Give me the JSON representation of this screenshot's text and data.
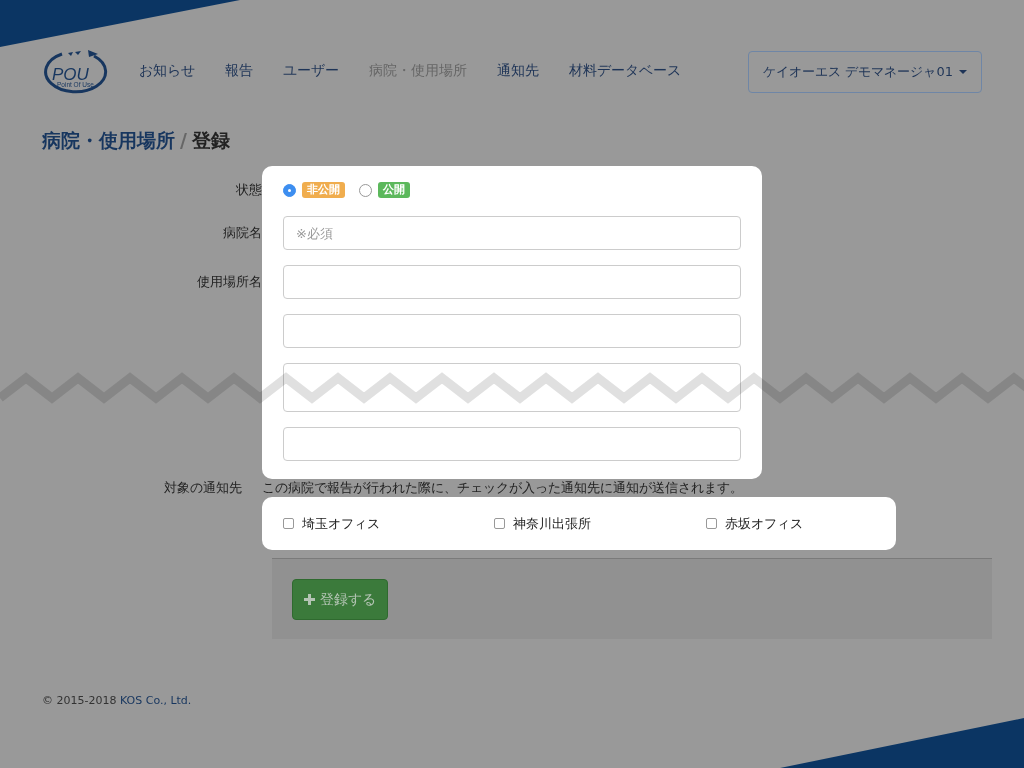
{
  "logo": {
    "text": "POU",
    "tagline": "Point Of Use"
  },
  "nav": [
    {
      "label": "お知らせ",
      "selected": false
    },
    {
      "label": "報告",
      "selected": false
    },
    {
      "label": "ユーザー",
      "selected": false
    },
    {
      "label": "病院・使用場所",
      "selected": true
    },
    {
      "label": "通知先",
      "selected": false
    },
    {
      "label": "材料データベース",
      "selected": false
    }
  ],
  "user_menu": {
    "label": "ケイオーエス デモマネージャ01"
  },
  "breadcrumb": {
    "parent": "病院・使用場所",
    "separator": "/",
    "current": "登録"
  },
  "status": {
    "label": "状態",
    "options": [
      {
        "label": "非公開",
        "selected": true,
        "color": "#f0ad4e"
      },
      {
        "label": "公開",
        "selected": false,
        "color": "#5cb85c"
      }
    ]
  },
  "fields": [
    {
      "kind": "labeled",
      "label": "病院名",
      "placeholder": "※必須"
    },
    {
      "kind": "labeled",
      "label": "使用場所名"
    },
    {
      "kind": "extra"
    },
    {
      "kind": "extra"
    },
    {
      "kind": "extra"
    }
  ],
  "notification": {
    "label": "対象の通知先",
    "description": "この病院で報告が行われた際に、チェックが入った通知先に通知が送信されます。",
    "targets": [
      {
        "label": "埼玉オフィス",
        "checked": false
      },
      {
        "label": "神奈川出張所",
        "checked": false
      },
      {
        "label": "赤坂オフィス",
        "checked": false
      }
    ]
  },
  "submit": {
    "label": "登録する"
  },
  "footer": {
    "text": "© 2015-2018",
    "link": "KOS Co., Ltd."
  }
}
